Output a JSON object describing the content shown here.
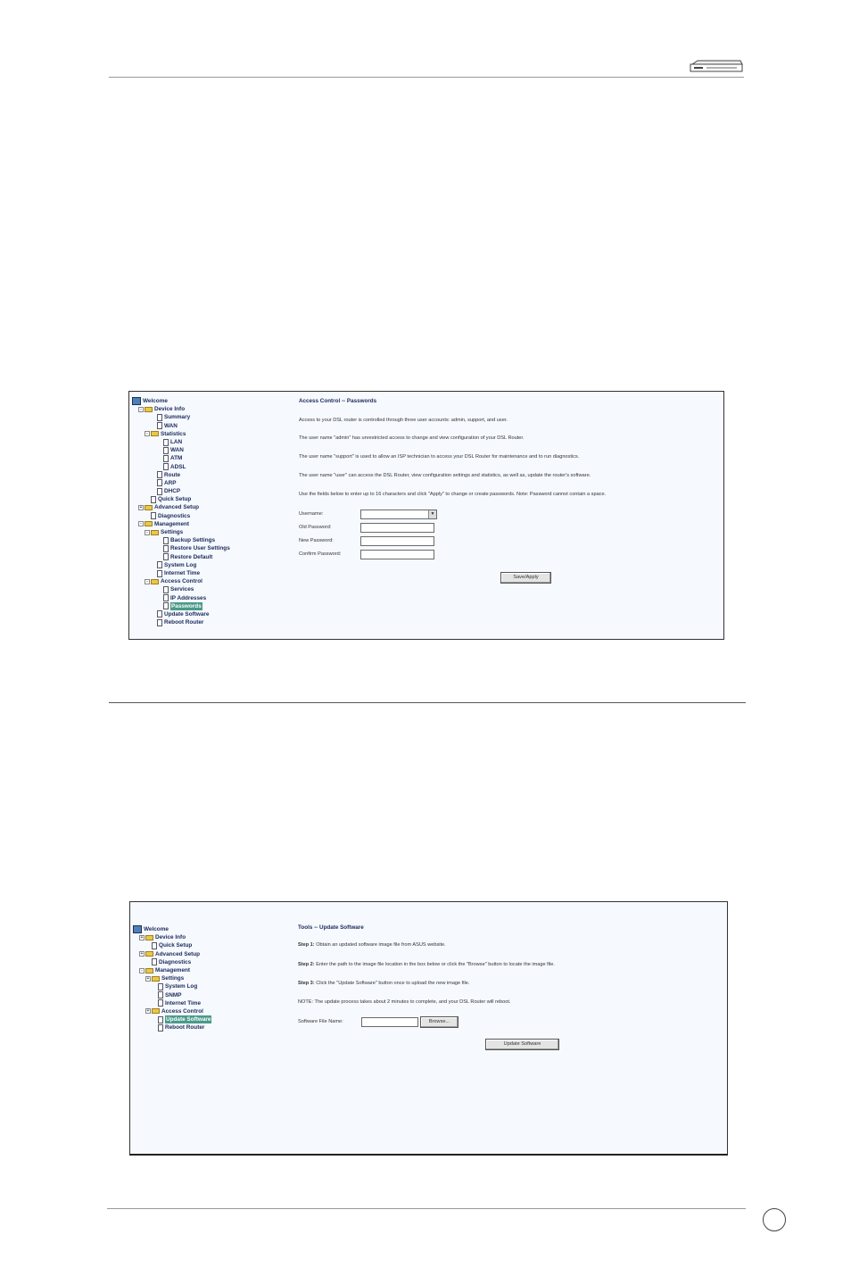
{
  "page": {
    "page_number": ""
  },
  "shot1": {
    "tree": [
      {
        "label": "Welcome",
        "kind": "globe",
        "indent": 0,
        "exp": ""
      },
      {
        "label": "Device Info",
        "kind": "folder",
        "indent": 1,
        "exp": "-"
      },
      {
        "label": "Summary",
        "kind": "doc",
        "indent": 3,
        "exp": ""
      },
      {
        "label": "WAN",
        "kind": "doc",
        "indent": 3,
        "exp": ""
      },
      {
        "label": "Statistics",
        "kind": "folder",
        "indent": 2,
        "exp": "-"
      },
      {
        "label": "LAN",
        "kind": "doc",
        "indent": 4,
        "exp": ""
      },
      {
        "label": "WAN",
        "kind": "doc",
        "indent": 4,
        "exp": ""
      },
      {
        "label": "ATM",
        "kind": "doc",
        "indent": 4,
        "exp": ""
      },
      {
        "label": "ADSL",
        "kind": "doc",
        "indent": 4,
        "exp": ""
      },
      {
        "label": "Route",
        "kind": "doc",
        "indent": 3,
        "exp": ""
      },
      {
        "label": "ARP",
        "kind": "doc",
        "indent": 3,
        "exp": ""
      },
      {
        "label": "DHCP",
        "kind": "doc",
        "indent": 3,
        "exp": ""
      },
      {
        "label": "Quick Setup",
        "kind": "doc",
        "indent": 2,
        "exp": ""
      },
      {
        "label": "Advanced Setup",
        "kind": "folder",
        "indent": 1,
        "exp": "+"
      },
      {
        "label": "Diagnostics",
        "kind": "doc",
        "indent": 2,
        "exp": ""
      },
      {
        "label": "Management",
        "kind": "folder",
        "indent": 1,
        "exp": "-"
      },
      {
        "label": "Settings",
        "kind": "folder",
        "indent": 2,
        "exp": "-"
      },
      {
        "label": "Backup Settings",
        "kind": "doc",
        "indent": 4,
        "exp": ""
      },
      {
        "label": "Restore User Settings",
        "kind": "doc",
        "indent": 4,
        "exp": ""
      },
      {
        "label": "Restore Default",
        "kind": "doc",
        "indent": 4,
        "exp": ""
      },
      {
        "label": "System Log",
        "kind": "doc",
        "indent": 3,
        "exp": ""
      },
      {
        "label": "Internet Time",
        "kind": "doc",
        "indent": 3,
        "exp": ""
      },
      {
        "label": "Access Control",
        "kind": "folder",
        "indent": 2,
        "exp": "-"
      },
      {
        "label": "Services",
        "kind": "doc",
        "indent": 4,
        "exp": ""
      },
      {
        "label": "IP Addresses",
        "kind": "doc",
        "indent": 4,
        "exp": ""
      },
      {
        "label": "Passwords",
        "kind": "doc",
        "indent": 4,
        "exp": "",
        "selected": true
      },
      {
        "label": "Update Software",
        "kind": "doc",
        "indent": 3,
        "exp": ""
      },
      {
        "label": "Reboot Router",
        "kind": "doc",
        "indent": 3,
        "exp": ""
      }
    ],
    "title": "Access Control -- Passwords",
    "paragraphs": [
      "Access to your DSL router is controlled through three user accounts: admin, support, and user.",
      "The user name \"admin\" has unrestricted access to change and view configuration of your DSL Router.",
      "The user name \"support\" is used to allow an ISP technician to access your DSL Router for maintenance and to run diagnostics.",
      "The user name \"user\" can access the DSL Router, view configuration settings and statistics, as well as, update the router's software.",
      "Use the fields below to enter up to 16 characters and click \"Apply\" to change or create passwords. Note: Password cannot contain a space."
    ],
    "fields": {
      "username_label": "Username:",
      "old_password_label": "Old Password:",
      "new_password_label": "New Password:",
      "confirm_password_label": "Confirm Password:",
      "username_value": "",
      "old_password_value": "",
      "new_password_value": "",
      "confirm_password_value": ""
    },
    "save_button": "Save/Apply"
  },
  "shot2": {
    "tree": [
      {
        "label": "Welcome",
        "kind": "globe",
        "indent": 0,
        "exp": ""
      },
      {
        "label": "Device Info",
        "kind": "folder",
        "indent": 1,
        "exp": "+"
      },
      {
        "label": "Quick Setup",
        "kind": "doc",
        "indent": 2,
        "exp": ""
      },
      {
        "label": "Advanced Setup",
        "kind": "folder",
        "indent": 1,
        "exp": "+"
      },
      {
        "label": "Diagnostics",
        "kind": "doc",
        "indent": 2,
        "exp": ""
      },
      {
        "label": "Management",
        "kind": "folder",
        "indent": 1,
        "exp": "-"
      },
      {
        "label": "Settings",
        "kind": "folder",
        "indent": 2,
        "exp": "+"
      },
      {
        "label": "System Log",
        "kind": "doc",
        "indent": 3,
        "exp": ""
      },
      {
        "label": "SNMP",
        "kind": "doc",
        "indent": 3,
        "exp": ""
      },
      {
        "label": "Internet Time",
        "kind": "doc",
        "indent": 3,
        "exp": ""
      },
      {
        "label": "Access Control",
        "kind": "folder",
        "indent": 2,
        "exp": "+"
      },
      {
        "label": "Update Software",
        "kind": "doc",
        "indent": 3,
        "exp": "",
        "selected": true
      },
      {
        "label": "Reboot Router",
        "kind": "doc",
        "indent": 3,
        "exp": ""
      }
    ],
    "title": "Tools -- Update Software",
    "steps": [
      {
        "bold": "Step 1:",
        "text": " Obtain an updated software image file from ASUS website."
      },
      {
        "bold": "Step 2:",
        "text": " Enter the path to the image file location in the box below or click the \"Browse\" button to locate the image file."
      },
      {
        "bold": "Step 3:",
        "text": " Click the \"Update Software\" button once to upload the new image file."
      }
    ],
    "note": "NOTE: The update process takes about 2 minutes to complete, and your DSL Router will reboot.",
    "file_label": "Software File Name:",
    "file_value": "",
    "browse_button": "Browse...",
    "update_button": "Update Software"
  }
}
